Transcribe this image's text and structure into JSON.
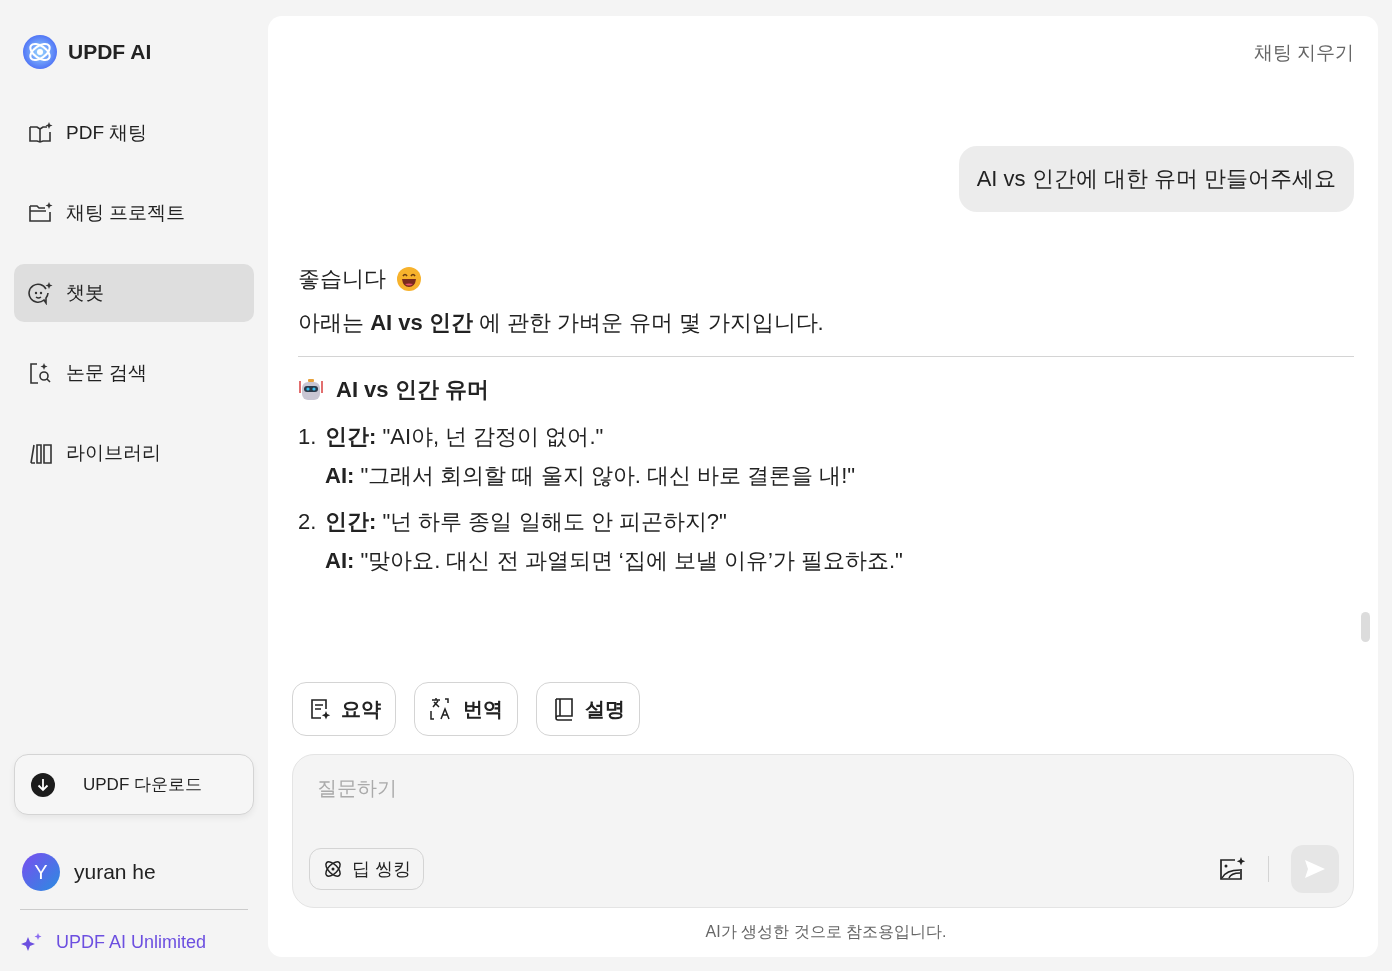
{
  "sidebar": {
    "logo": "UPDF AI",
    "items": [
      {
        "label": "PDF 채팅",
        "selected": false
      },
      {
        "label": "채팅 프로젝트",
        "selected": false
      },
      {
        "label": "챗봇",
        "selected": true
      },
      {
        "label": "논문 검색",
        "selected": false
      },
      {
        "label": "라이브러리",
        "selected": false
      }
    ],
    "download_button": "UPDF 다운로드",
    "user": {
      "initial": "Y",
      "name": "yuran he"
    },
    "upgrade_link": "UPDF AI Unlimited"
  },
  "chat": {
    "clear_button": "채팅 지우기",
    "user_message": "AI vs 인간에 대한 유머 만들어주세요",
    "reply": {
      "greeting": "좋습니다",
      "intro": "아래는 **AI vs 인간** 에 관한 가벼운 유머 몇 가지입니다.",
      "heading": "AI vs 인간 유머",
      "jokes": [
        {
          "number": "1.",
          "human": "**인간:** \"AI야, 넌 감정이 없어.\"",
          "ai": "**AI:** \"그래서 회의할 때 울지 않아. 대신 바로 결론을 내!\""
        },
        {
          "number": "2.",
          "human": "**인간:** \"넌 하루 종일 일해도 안 피곤하지?\"",
          "ai": "**AI:** \"맞아요. 대신 전 과열되면 ‘집에 보낼 이유’가 필요하죠.\""
        }
      ]
    },
    "quick_actions": [
      "요약",
      "번역",
      "설명"
    ],
    "input": {
      "placeholder": "질문하기",
      "deep_thinking_button": "딥 씽킹"
    },
    "disclaimer": "AI가 생성한 것으로 참조용입니다."
  }
}
